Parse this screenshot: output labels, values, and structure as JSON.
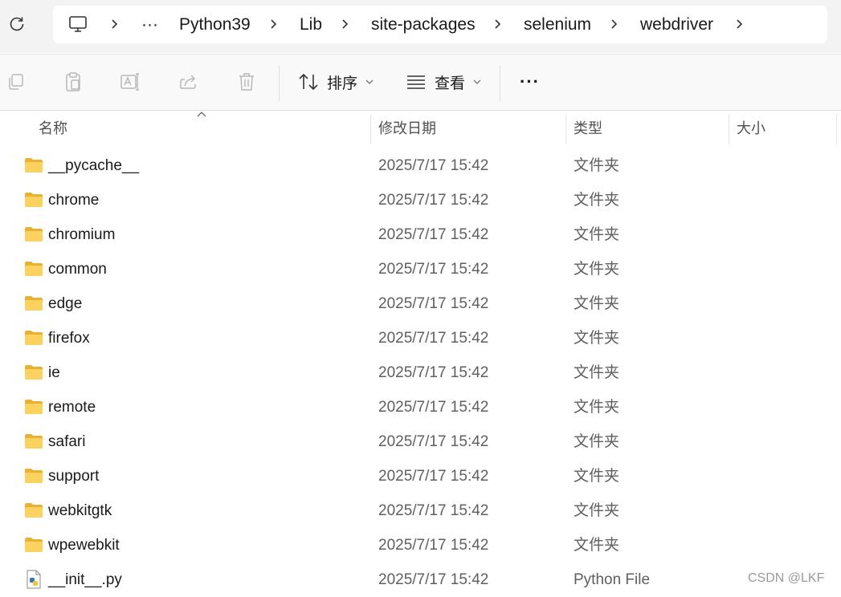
{
  "breadcrumb": {
    "more": "···",
    "segments": [
      "Python39",
      "Lib",
      "site-packages",
      "selenium",
      "webdriver"
    ]
  },
  "toolbar": {
    "sort_label": "排序",
    "view_label": "查看",
    "more": "···"
  },
  "columns": {
    "name": "名称",
    "date": "修改日期",
    "type": "类型",
    "size": "大小"
  },
  "files": [
    {
      "name": "__pycache__",
      "date": "2025/7/17 15:42",
      "type": "文件夹",
      "icon": "folder-icon"
    },
    {
      "name": "chrome",
      "date": "2025/7/17 15:42",
      "type": "文件夹",
      "icon": "folder-icon"
    },
    {
      "name": "chromium",
      "date": "2025/7/17 15:42",
      "type": "文件夹",
      "icon": "folder-icon"
    },
    {
      "name": "common",
      "date": "2025/7/17 15:42",
      "type": "文件夹",
      "icon": "folder-icon"
    },
    {
      "name": "edge",
      "date": "2025/7/17 15:42",
      "type": "文件夹",
      "icon": "folder-icon"
    },
    {
      "name": "firefox",
      "date": "2025/7/17 15:42",
      "type": "文件夹",
      "icon": "folder-icon"
    },
    {
      "name": "ie",
      "date": "2025/7/17 15:42",
      "type": "文件夹",
      "icon": "folder-icon"
    },
    {
      "name": "remote",
      "date": "2025/7/17 15:42",
      "type": "文件夹",
      "icon": "folder-icon"
    },
    {
      "name": "safari",
      "date": "2025/7/17 15:42",
      "type": "文件夹",
      "icon": "folder-icon"
    },
    {
      "name": "support",
      "date": "2025/7/17 15:42",
      "type": "文件夹",
      "icon": "folder-icon"
    },
    {
      "name": "webkitgtk",
      "date": "2025/7/17 15:42",
      "type": "文件夹",
      "icon": "folder-icon"
    },
    {
      "name": "wpewebkit",
      "date": "2025/7/17 15:42",
      "type": "文件夹",
      "icon": "folder-icon"
    },
    {
      "name": "__init__.py",
      "date": "2025/7/17 15:42",
      "type": "Python File",
      "icon": "python-file-icon"
    }
  ],
  "watermark": "CSDN @LKF"
}
